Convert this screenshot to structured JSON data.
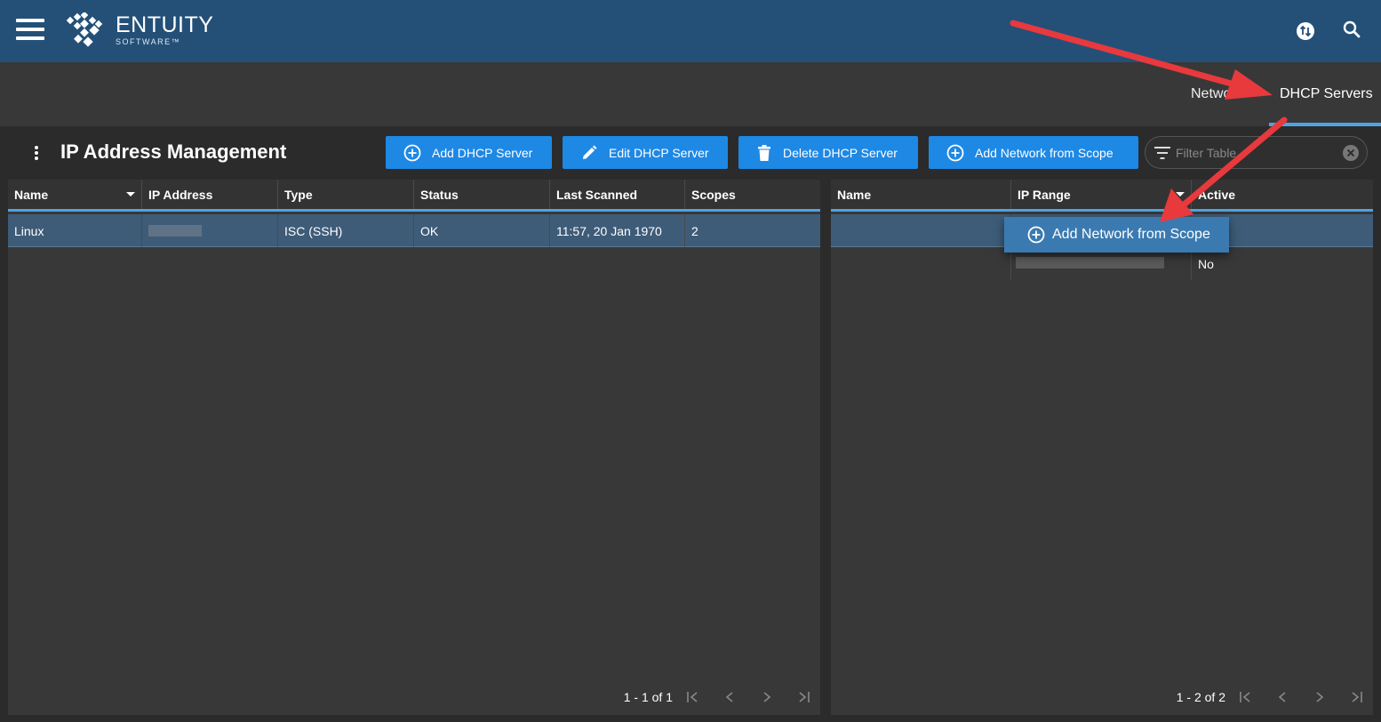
{
  "app": {
    "brand_name": "ENTUITY",
    "brand_sub": "SOFTWARE™"
  },
  "nav": {
    "tabs": [
      {
        "label": "Network"
      },
      {
        "label": "DHCP Servers",
        "active": true
      }
    ]
  },
  "page": {
    "title": "IP Address Management"
  },
  "toolbar": {
    "add_dhcp": "Add DHCP Server",
    "edit_dhcp": "Edit DHCP Server",
    "delete_dhcp": "Delete DHCP Server",
    "add_network": "Add Network from Scope",
    "filter_placeholder": "Filter Table"
  },
  "servers_table": {
    "columns": [
      "Name",
      "IP Address",
      "Type",
      "Status",
      "Last Scanned",
      "Scopes"
    ],
    "rows": [
      {
        "name": "Linux",
        "ip": "",
        "type": "ISC (SSH)",
        "status": "OK",
        "last_scanned": "11:57, 20 Jan 1970",
        "scopes": "2"
      }
    ],
    "pagination": "1 - 1 of 1"
  },
  "scopes_table": {
    "columns": [
      "Name",
      "IP Range",
      "Active"
    ],
    "rows": [
      {
        "active": ""
      },
      {
        "active": "No"
      }
    ],
    "pagination": "1 - 2 of 2"
  },
  "context_menu": {
    "item": "Add Network from Scope"
  },
  "icons": [
    "menu-icon",
    "entuity-logo-icon",
    "sync-icon",
    "search-icon",
    "kebab-icon",
    "add-circle-icon",
    "pencil-icon",
    "trash-icon",
    "filter-icon",
    "clear-icon",
    "first-page-icon",
    "prev-page-icon",
    "next-page-icon",
    "last-page-icon"
  ],
  "colors": {
    "topbar": "#245078",
    "accent": "#1e88e5",
    "selected_row": "#3e5c78",
    "annotation_arrow": "#e8393d"
  }
}
